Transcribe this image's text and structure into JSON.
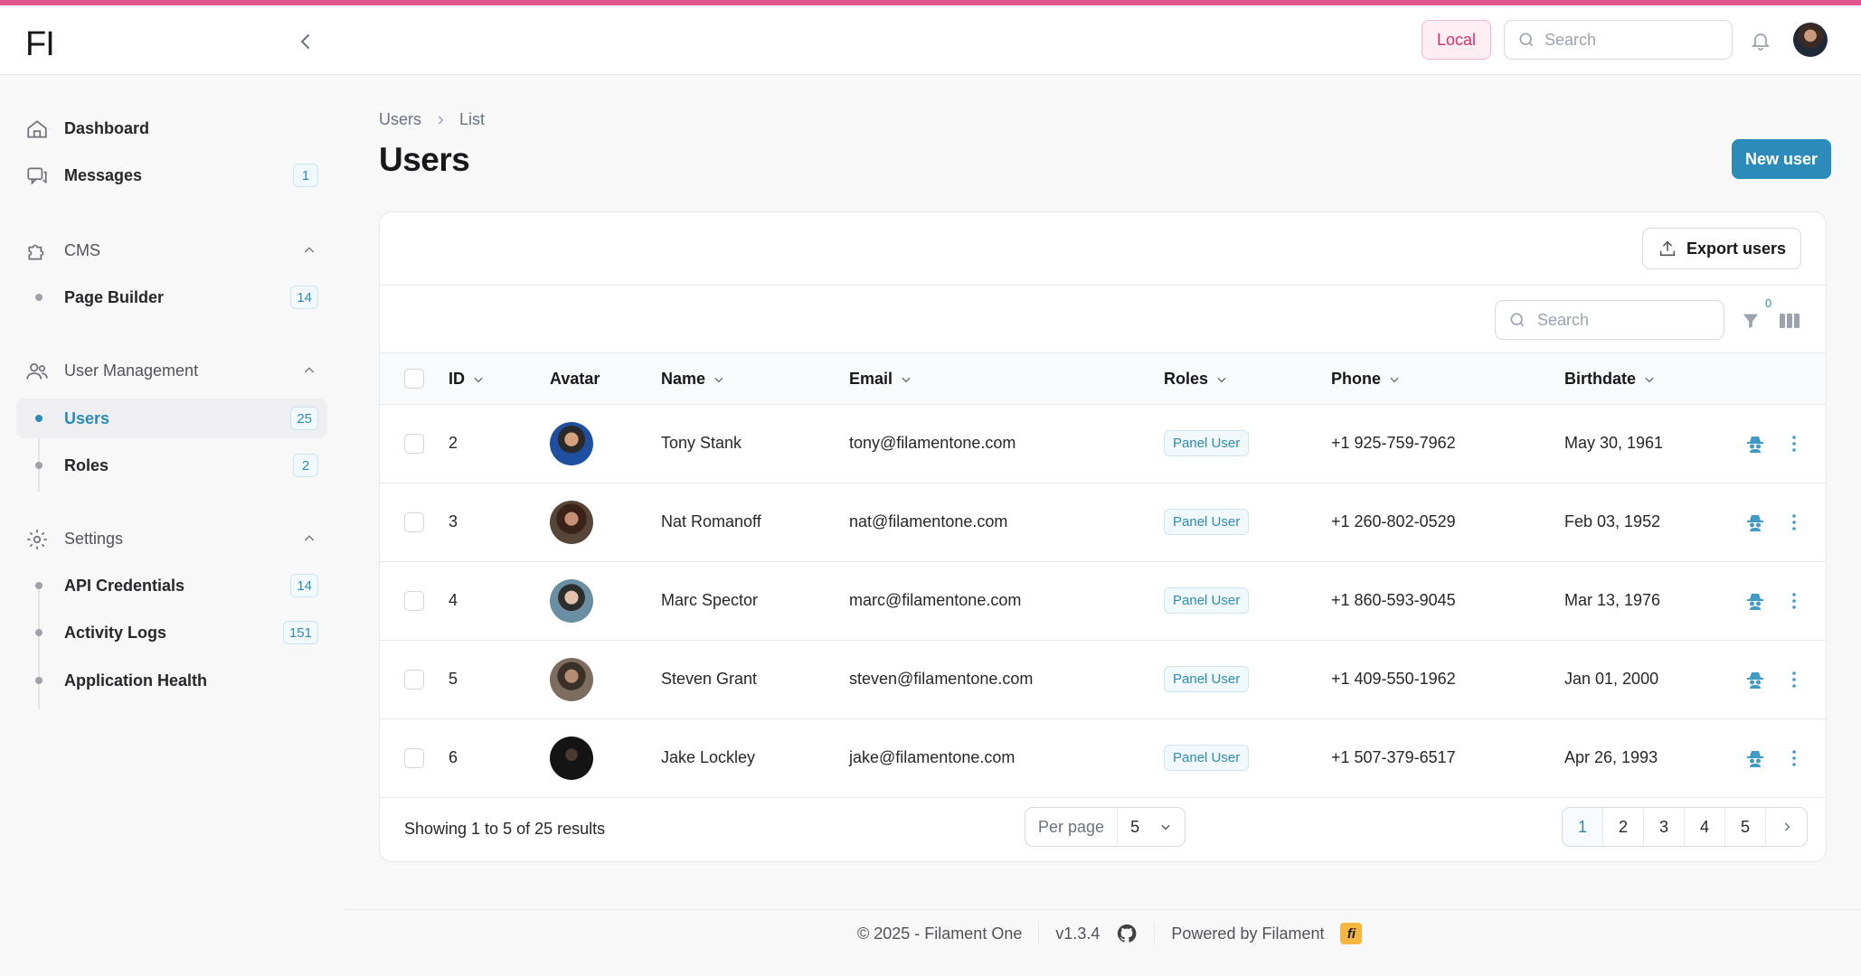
{
  "app": {
    "logo": "FI",
    "env_badge": "Local",
    "search_placeholder": "Search"
  },
  "sidebar": {
    "dashboard": "Dashboard",
    "messages": {
      "label": "Messages",
      "count": "1"
    },
    "cms": {
      "label": "CMS",
      "items": [
        {
          "label": "Page Builder",
          "count": "14"
        }
      ]
    },
    "user_management": {
      "label": "User Management",
      "items": [
        {
          "label": "Users",
          "count": "25"
        },
        {
          "label": "Roles",
          "count": "2"
        }
      ]
    },
    "settings": {
      "label": "Settings",
      "items": [
        {
          "label": "API Credentials",
          "count": "14"
        },
        {
          "label": "Activity Logs",
          "count": "151"
        },
        {
          "label": "Application Health",
          "count": ""
        }
      ]
    }
  },
  "page": {
    "breadcrumb": [
      "Users",
      "List"
    ],
    "title": "Users",
    "new_button": "New user",
    "export_button": "Export users",
    "table_search_placeholder": "Search",
    "filter_count": "0"
  },
  "table": {
    "headers": {
      "id": "ID",
      "avatar": "Avatar",
      "name": "Name",
      "email": "Email",
      "roles": "Roles",
      "phone": "Phone",
      "birthdate": "Birthdate"
    },
    "rows": [
      {
        "id": "2",
        "name": "Tony Stank",
        "email": "tony@filamentone.com",
        "role": "Panel User",
        "phone": "+1 925-759-7962",
        "birthdate": "May 30, 1961"
      },
      {
        "id": "3",
        "name": "Nat Romanoff",
        "email": "nat@filamentone.com",
        "role": "Panel User",
        "phone": "+1 260-802-0529",
        "birthdate": "Feb 03, 1952"
      },
      {
        "id": "4",
        "name": "Marc Spector",
        "email": "marc@filamentone.com",
        "role": "Panel User",
        "phone": "+1 860-593-9045",
        "birthdate": "Mar 13, 1976"
      },
      {
        "id": "5",
        "name": "Steven Grant",
        "email": "steven@filamentone.com",
        "role": "Panel User",
        "phone": "+1 409-550-1962",
        "birthdate": "Jan 01, 2000"
      },
      {
        "id": "6",
        "name": "Jake Lockley",
        "email": "jake@filamentone.com",
        "role": "Panel User",
        "phone": "+1 507-379-6517",
        "birthdate": "Apr 26, 1993"
      }
    ],
    "summary": "Showing 1 to 5 of 25 results",
    "per_page_label": "Per page",
    "per_page_value": "5",
    "pages": [
      "1",
      "2",
      "3",
      "4",
      "5"
    ]
  },
  "footer": {
    "copyright": "© 2025 - Filament One",
    "version": "v1.3.4",
    "powered": "Powered by Filament",
    "fi_logo": "fi"
  },
  "colors": {
    "accent": "#2c8bb8",
    "top_strip": "#e0548f",
    "env_badge": "#d6336c"
  }
}
